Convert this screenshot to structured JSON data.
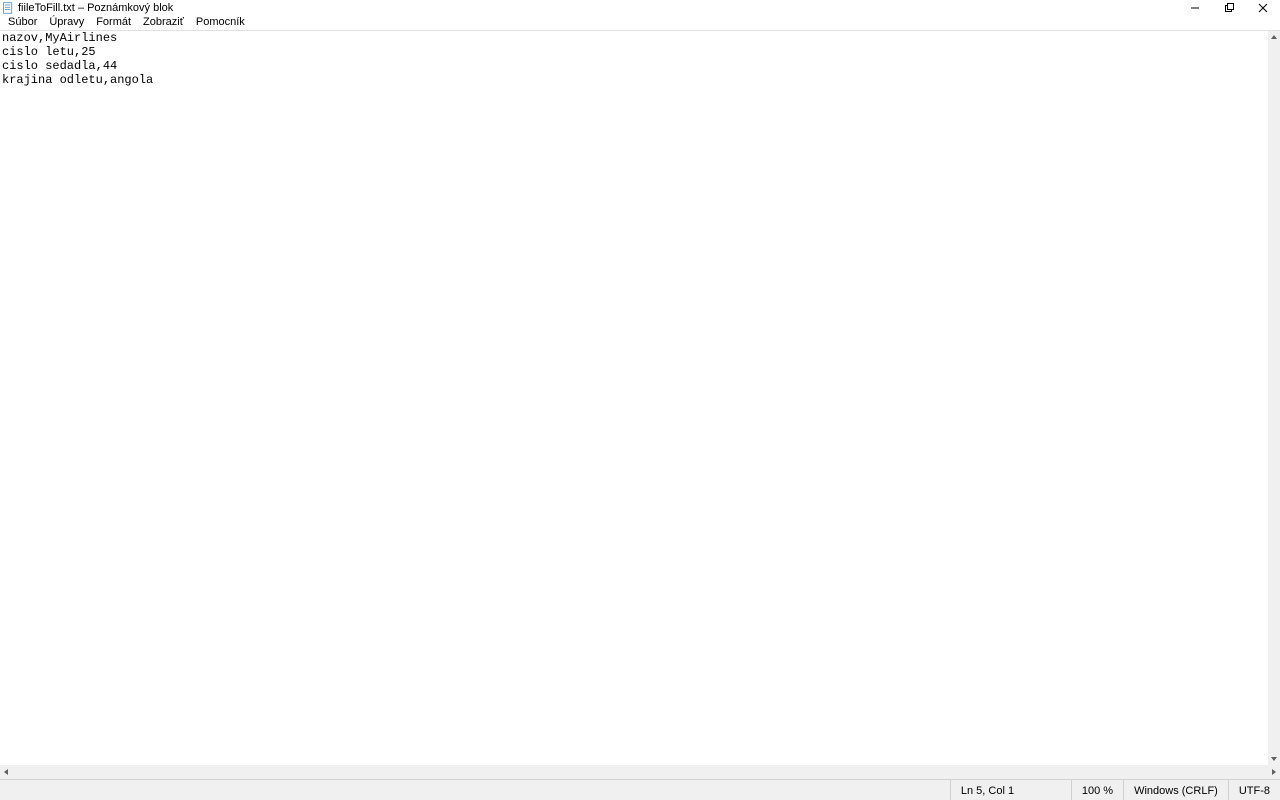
{
  "window": {
    "title": "fiileToFill.txt – Poznámkový blok"
  },
  "menu": {
    "file": "Súbor",
    "edit": "Úpravy",
    "format": "Formát",
    "view": "Zobraziť",
    "help": "Pomocník"
  },
  "editor": {
    "content": "nazov,MyAirlines\ncislo letu,25\ncislo sedadla,44\nkrajina odletu,angola\n"
  },
  "status": {
    "position": "Ln 5, Col 1",
    "zoom": "100 %",
    "line_ending": "Windows (CRLF)",
    "encoding": "UTF-8"
  }
}
